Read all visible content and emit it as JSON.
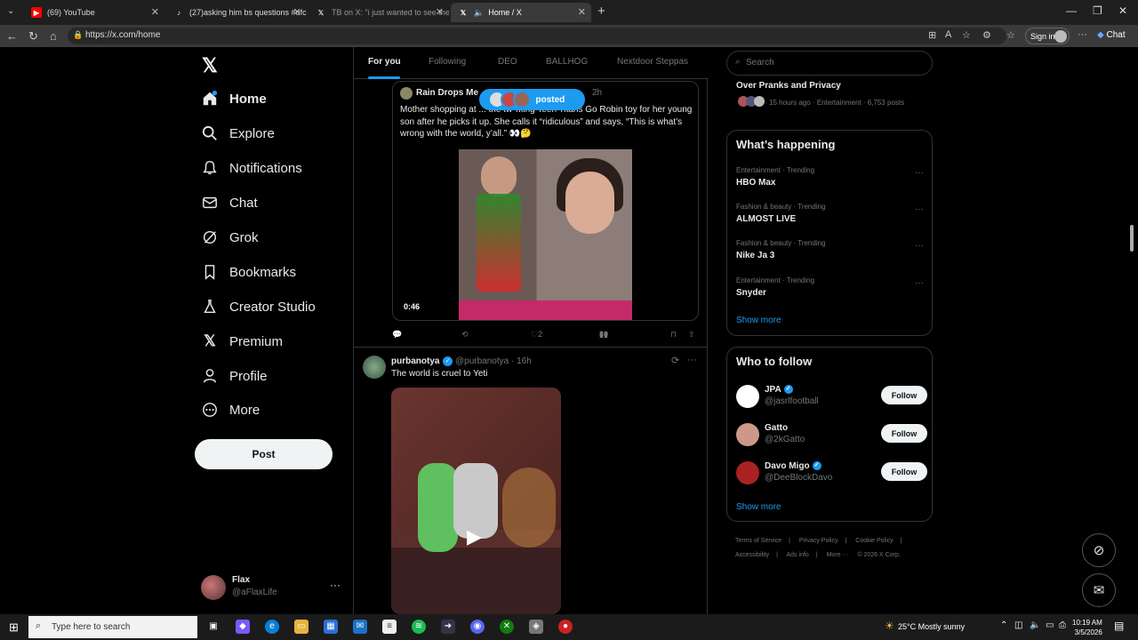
{
  "browser": {
    "tabs": [
      {
        "title": "(69) YouTube"
      },
      {
        "title": "(27)asking him bs questions #ufc"
      },
      {
        "title": "TB on X: \"i just wanted to see the"
      },
      {
        "title": "Home / X"
      }
    ],
    "url": "https://x.com/home",
    "signin_label": "Sign in",
    "chat_label": "Chat"
  },
  "nav": {
    "items": [
      {
        "label": "Home"
      },
      {
        "label": "Explore"
      },
      {
        "label": "Notifications"
      },
      {
        "label": "Chat"
      },
      {
        "label": "Grok"
      },
      {
        "label": "Bookmarks"
      },
      {
        "label": "Creator Studio"
      },
      {
        "label": "Premium"
      },
      {
        "label": "Profile"
      },
      {
        "label": "More"
      }
    ],
    "post_label": "Post",
    "account": {
      "name": "Flax",
      "handle": "@aFlaxLife"
    }
  },
  "feed": {
    "tabs": [
      "For you",
      "Following",
      "DEO",
      "BALLHOG",
      "Nextdoor Steppas"
    ],
    "new_posts_label": "posted",
    "quote": {
      "author": "Rain Drops Me",
      "time": "2h",
      "text": "Mother shopping at ... the tw*rking Teen Titans Go Robin toy for her young son after he picks it up. She calls it “ridiculous” and says, “This is what’s wrong with the world, y’all.” 👀🤔",
      "video_duration": "0:46"
    },
    "quote_actions": {
      "replies": "",
      "reposts": "",
      "likes": "2",
      "views": "80"
    },
    "post2": {
      "name": "purbanotya",
      "handle": "@purbanotya · 16h",
      "text": "The world is cruel to Yeti"
    }
  },
  "sidebar": {
    "search_placeholder": "Search",
    "event": {
      "title": "Over Pranks and Privacy",
      "meta": "15 hours ago · Entertainment · 6,753 posts"
    },
    "happening": {
      "title": "What’s happening",
      "trends": [
        {
          "category": "Entertainment · Trending",
          "topic": "HBO Max"
        },
        {
          "category": "Fashion & beauty · Trending",
          "topic": "ALMOST LIVE"
        },
        {
          "category": "Fashion & beauty · Trending",
          "topic": "Nike Ja 3"
        },
        {
          "category": "Entertainment · Trending",
          "topic": "Snyder"
        }
      ],
      "show_more": "Show more"
    },
    "who_to_follow": {
      "title": "Who to follow",
      "accounts": [
        {
          "name": "JPA",
          "handle": "@jasrlfootball",
          "button": "Follow"
        },
        {
          "name": "Gatto",
          "handle": "@2kGatto",
          "button": "Follow"
        },
        {
          "name": "Davo Migo",
          "handle": "@DeeBlockDavo",
          "button": "Follow"
        }
      ],
      "show_more": "Show more"
    },
    "footer": [
      "Terms of Service",
      "|",
      "Privacy Policy",
      "|",
      "Cookie Policy",
      "|",
      "Accessibility",
      "|",
      "Ads info",
      "|",
      "More ···",
      "© 2026 X Corp."
    ]
  },
  "taskbar": {
    "search_placeholder": "Type here to search",
    "weather": "25°C  Mostly sunny",
    "time": "10:19 AM",
    "date": "3/5/2026"
  },
  "colors": {
    "accent": "#1d9bf0",
    "background": "#000000",
    "border": "#2f3336",
    "muted": "#71767b"
  }
}
